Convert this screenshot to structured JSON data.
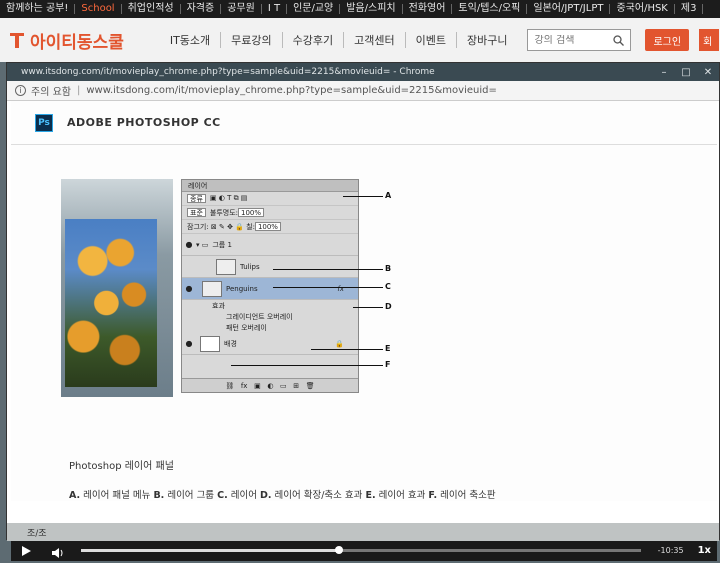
{
  "site": {
    "topnav": [
      "함께하는 공부!",
      "School",
      "취업인적성",
      "자격증",
      "공무원",
      "I T",
      "인문/교양",
      "발음/스피치",
      "전화영어",
      "토익/텝스/오픽",
      "일본어/JPT/JLPT",
      "중국어/HSK",
      "제3"
    ],
    "logo_text": "아이티동스쿨",
    "nav": [
      "IT동소개",
      "무료강의",
      "수강후기",
      "고객센터",
      "이벤트",
      "장바구니"
    ],
    "search_placeholder": "강의 검색",
    "login_label": "로그인",
    "join_label": "회"
  },
  "popup": {
    "window_title": "www.itsdong.com/it/movieplay_chrome.php?type=sample&uid=2215&movieuid= - Chrome",
    "security_label": "주의 요함",
    "url": "www.itsdong.com/it/movieplay_chrome.php?type=sample&uid=2215&movieuid="
  },
  "lesson": {
    "app_icon": "Ps",
    "title": "ADOBE PHOTOSHOP CC",
    "caption": "Photoshop 레이어 패널",
    "legend": [
      {
        "key": "A.",
        "text": "레이어 패널 메뉴"
      },
      {
        "key": "B.",
        "text": "레이어 그룹"
      },
      {
        "key": "C.",
        "text": "레이어"
      },
      {
        "key": "D.",
        "text": "레이어 확장/축소 효과"
      },
      {
        "key": "E.",
        "text": "레이어 효과"
      },
      {
        "key": "F.",
        "text": "레이어 축소판"
      }
    ]
  },
  "figure": {
    "panel_tab": "레이어",
    "kind_label": "종류",
    "blend_mode": "표준",
    "opacity_label": "불투명도:",
    "opacity_value": "100%",
    "lock_label": "잠그기:",
    "fill_label": "칠:",
    "fill_value": "100%",
    "group_name": "그룹 1",
    "layer1": "Tulips",
    "layer2": "Penguins",
    "fx_label": "fx",
    "effects_label": "효과",
    "effect1": "그레이디언트 오버레이",
    "effect2": "패턴 오버레이",
    "bg_layer": "배경",
    "callouts": [
      "A",
      "B",
      "C",
      "D",
      "E",
      "F"
    ]
  },
  "player": {
    "time_remaining": "-10:35",
    "speed": "1x",
    "progress": 0.46
  },
  "below_text": "조/조"
}
